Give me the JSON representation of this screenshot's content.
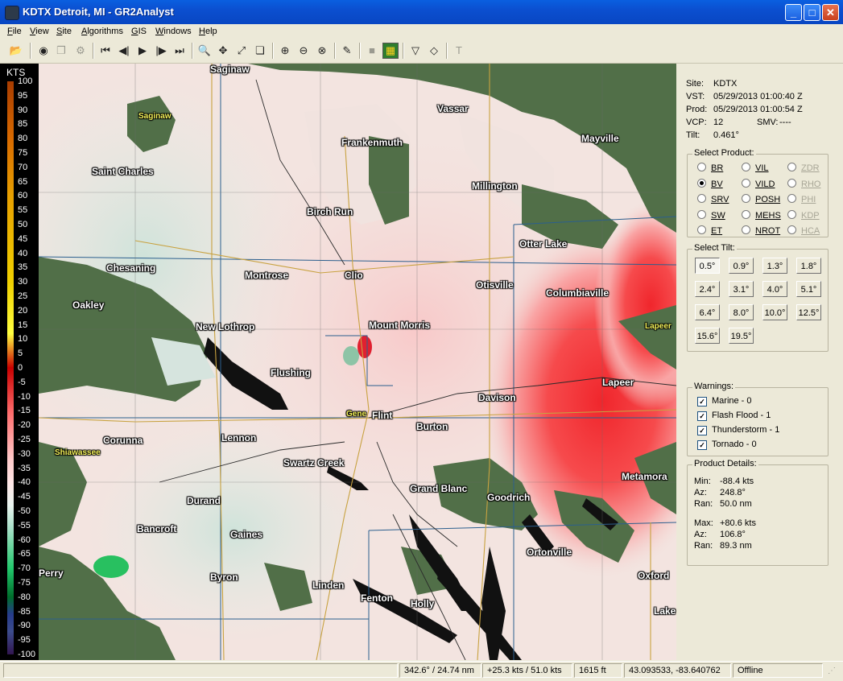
{
  "window": {
    "title": "KDTX Detroit, MI - GR2Analyst"
  },
  "menu": [
    "File",
    "View",
    "Site",
    "Algorithms",
    "GIS",
    "Windows",
    "Help"
  ],
  "scale": {
    "unit": "KTS",
    "ticks": [
      "100",
      "95",
      "90",
      "85",
      "80",
      "75",
      "70",
      "65",
      "60",
      "55",
      "50",
      "45",
      "40",
      "35",
      "30",
      "25",
      "20",
      "15",
      "10",
      "5",
      "0",
      "-5",
      "-10",
      "-15",
      "-20",
      "-25",
      "-30",
      "-35",
      "-40",
      "-45",
      "-50",
      "-55",
      "-60",
      "-65",
      "-70",
      "-75",
      "-80",
      "-85",
      "-90",
      "-95",
      "-100"
    ]
  },
  "cities": {
    "saginaw": "Saginaw",
    "saginaw_county": "Saginaw",
    "vassar": "Vassar",
    "frankenmuth": "Frankenmuth",
    "mayville": "Mayville",
    "saint_charles": "Saint Charles",
    "millington": "Millington",
    "birch_run": "Birch Run",
    "otter_lake": "Otter Lake",
    "chesaning": "Chesaning",
    "montrose": "Montrose",
    "clio": "Clio",
    "otisville": "Otisville",
    "columbiaville": "Columbiaville",
    "oakley": "Oakley",
    "new_lothrop": "New Lothrop",
    "mount_morris": "Mount Morris",
    "lapeer_county": "Lapeer",
    "flushing": "Flushing",
    "lapeer": "Lapeer",
    "davison": "Davison",
    "genesee_county": "Gene",
    "flint": "Flint",
    "burton": "Burton",
    "corunna": "Corunna",
    "lennon": "Lennon",
    "shiawassee_county": "Shiawassee",
    "swartz_creek": "Swartz Creek",
    "grand_blanc": "Grand Blanc",
    "metamora": "Metamora",
    "goodrich": "Goodrich",
    "durand": "Durand",
    "bancroft": "Bancroft",
    "gaines": "Gaines",
    "ortonville": "Ortonville",
    "perry": "Perry",
    "byron": "Byron",
    "oxford": "Oxford",
    "linden": "Linden",
    "fenton": "Fenton",
    "holly": "Holly",
    "lake": "Lake"
  },
  "site_info": {
    "site_label": "Site:",
    "site": "KDTX",
    "vst_label": "VST:",
    "vst": "05/29/2013  01:00:40 Z",
    "prod_label": "Prod:",
    "prod": "05/29/2013  01:00:54 Z",
    "vcp_label": "VCP:",
    "vcp": "12",
    "smv_label": "SMV:",
    "smv": "----",
    "tilt_label": "Tilt:",
    "tilt": "0.461°"
  },
  "select_product": {
    "title": "Select Product:",
    "col1": [
      "BR",
      "BV",
      "SRV",
      "SW",
      "ET"
    ],
    "col2": [
      "VIL",
      "VILD",
      "POSH",
      "MEHS",
      "NROT"
    ],
    "col3": [
      "ZDR",
      "RHO",
      "PHI",
      "KDP",
      "HCA"
    ],
    "selected": "BV"
  },
  "select_tilt": {
    "title": "Select Tilt:",
    "tilts": [
      "0.5°",
      "0.9°",
      "1.3°",
      "1.8°",
      "2.4°",
      "3.1°",
      "4.0°",
      "5.1°",
      "6.4°",
      "8.0°",
      "10.0°",
      "12.5°",
      "15.6°",
      "19.5°"
    ],
    "active": "0.5°"
  },
  "warnings": {
    "title": "Warnings:",
    "items": [
      "Marine - 0",
      "Flash Flood - 1",
      "Thunderstorm - 1",
      "Tornado - 0"
    ]
  },
  "product_details": {
    "title": "Product Details:",
    "min_label": "Min:",
    "min": "-88.4 kts",
    "min_az_label": "Az:",
    "min_az": "248.8°",
    "min_ran_label": "Ran:",
    "min_ran": "50.0 nm",
    "max_label": "Max:",
    "max": "+80.6 kts",
    "max_az_label": "Az:",
    "max_az": "106.8°",
    "max_ran_label": "Ran:",
    "max_ran": "89.3 nm"
  },
  "status": {
    "cursor_polar": "342.6° / 24.74 nm",
    "velocity": "+25.3 kts / 51.0 kts",
    "height": "1615 ft",
    "latlon": "43.093533, -83.640762",
    "state": "Offline"
  }
}
